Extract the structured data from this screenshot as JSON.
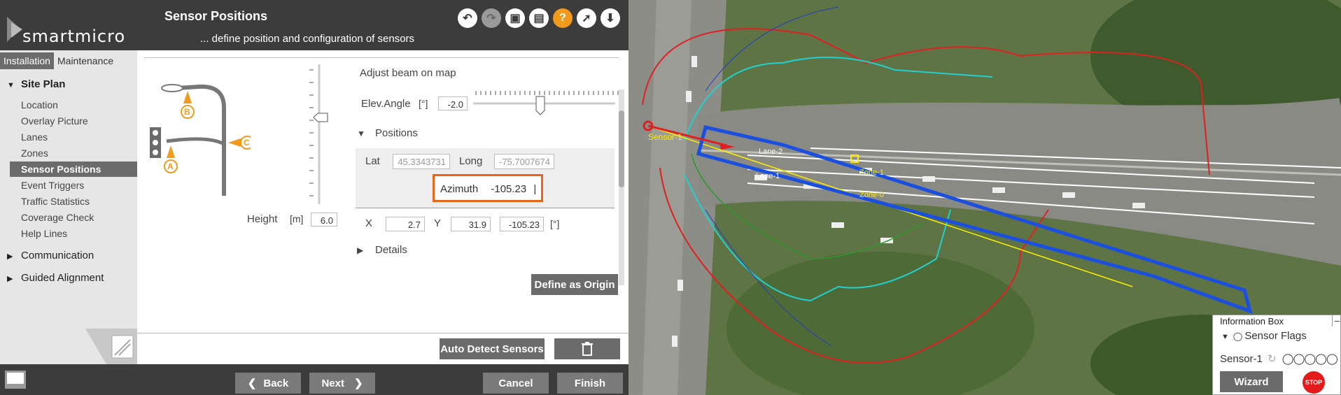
{
  "header": {
    "brand": "smartmicro",
    "title": "Sensor Positions",
    "subtitle": "... define position and configuration of sensors",
    "toolbar_icons": [
      "undo-icon",
      "redo-icon",
      "save-icon",
      "save-as-icon",
      "help-icon",
      "pointer-help-icon",
      "download-icon"
    ]
  },
  "tabs": [
    {
      "label": "Installation",
      "active": true
    },
    {
      "label": "Maintenance",
      "active": false
    }
  ],
  "sidebar": {
    "site_plan": "Site Plan",
    "items": [
      {
        "label": "Location"
      },
      {
        "label": "Overlay Picture"
      },
      {
        "label": "Lanes"
      },
      {
        "label": "Zones"
      },
      {
        "label": "Sensor Positions",
        "selected": true
      },
      {
        "label": "Event Triggers"
      },
      {
        "label": "Traffic Statistics"
      },
      {
        "label": "Coverage Check"
      },
      {
        "label": "Help Lines"
      }
    ],
    "communication": "Communication",
    "guided_alignment": "Guided Alignment"
  },
  "diagram": {
    "label_a": "A",
    "label_b": "B",
    "label_c": "C"
  },
  "height": {
    "label": "Height",
    "unit": "[m]",
    "value": "6.0",
    "level": 0.6
  },
  "beam": {
    "title": "Adjust beam on map",
    "elev_label": "Elev.Angle",
    "elev_unit": "[°]",
    "elev_value": "-2.0"
  },
  "positions": {
    "section": "Positions",
    "lat_label": "Lat",
    "lat_value": "45.3343731",
    "long_label": "Long",
    "long_value": "-75.7007674",
    "azimuth_label": "Azimuth",
    "azimuth_value": "-105.23",
    "azimuth_cursor": "|",
    "x_label": "X",
    "x_value": "2.7",
    "y_label": "Y",
    "y_value": "31.9",
    "angle_value": "-105.23",
    "angle_unit": "[°]"
  },
  "details": "Details",
  "define_origin": "Define as Origin",
  "auto_detect": "Auto Detect Sensors",
  "footer": {
    "back": "Back",
    "next": "Next",
    "cancel": "Cancel",
    "finish": "Finish"
  },
  "map": {
    "sensor_label": "Sensor-1",
    "lane_labels": [
      "Lane-2",
      "Lane-1"
    ],
    "zone_labels": [
      "Zone-1",
      "Zone-0"
    ],
    "beam_color": "#1a4fe0"
  },
  "infobox": {
    "title": "Information Box",
    "minimize": "–",
    "flags": "Sensor Flags",
    "sensor": "Sensor-1",
    "wizard": "Wizard",
    "stop": "STOP"
  }
}
